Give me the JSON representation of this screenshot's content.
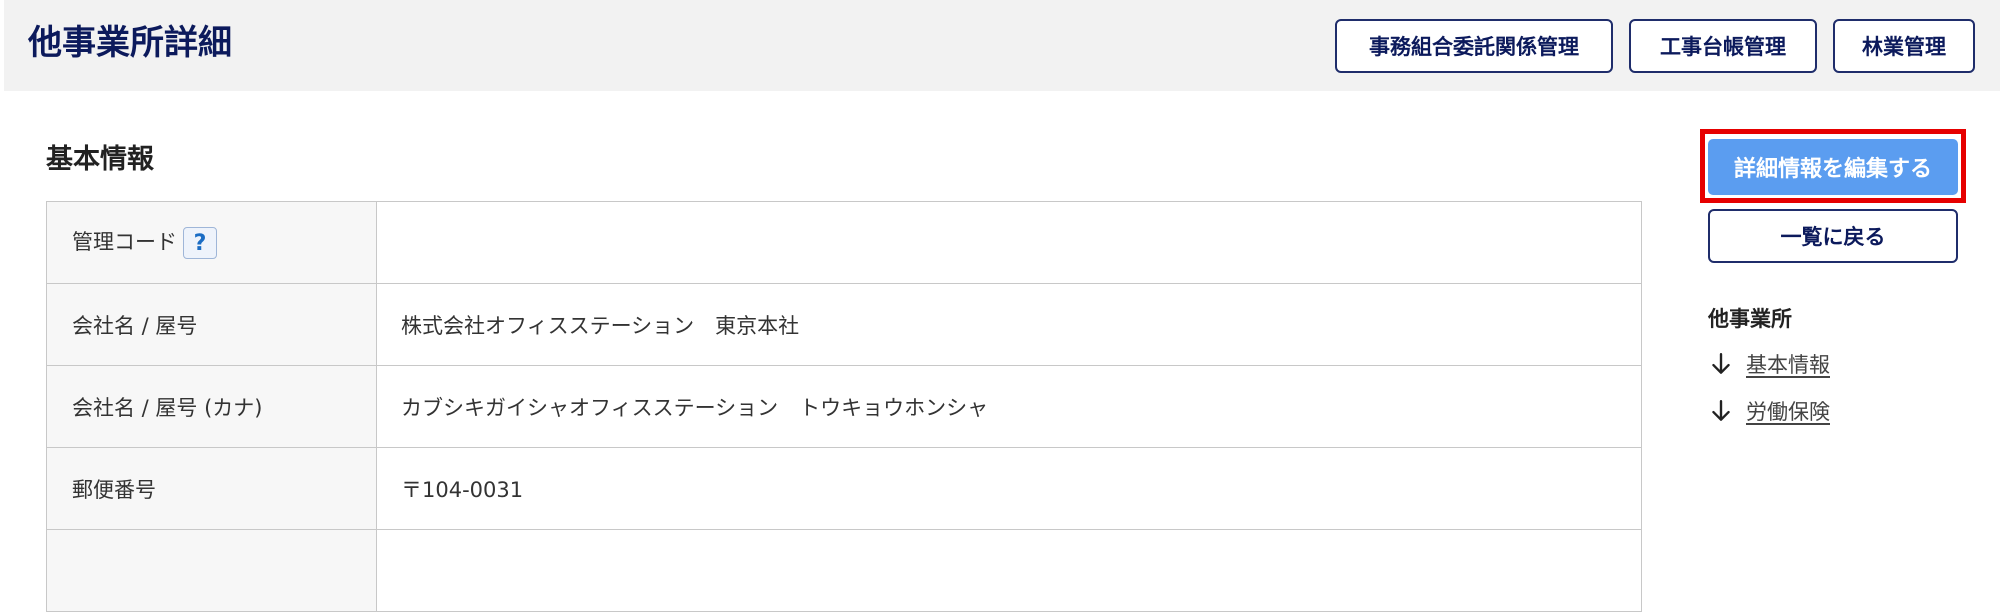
{
  "header": {
    "title": "他事業所詳細",
    "buttons": [
      "事務組合委託関係管理",
      "工事台帳管理",
      "林業管理"
    ]
  },
  "basic_info": {
    "section_title": "基本情報",
    "rows": [
      {
        "label": "管理コード",
        "value": "",
        "help": "?"
      },
      {
        "label": "会社名 / 屋号",
        "value": "株式会社オフィスステーション　東京本社"
      },
      {
        "label": "会社名 / 屋号 (カナ)",
        "value": "カブシキガイシャオフィスステーション　トウキョウホンシャ"
      },
      {
        "label": "郵便番号",
        "value": "〒104-0031"
      }
    ]
  },
  "side": {
    "edit_button": "詳細情報を編集する",
    "back_button": "一覧に戻る",
    "nav_heading": "他事業所",
    "nav_links": [
      "基本情報",
      "労働保険"
    ],
    "nav_icon": "arrow-down-icon"
  },
  "colors": {
    "title_navy": "#0c1a5c",
    "header_bg": "#f2f2f2",
    "edit_button_bg": "#5b9df0",
    "highlight_red": "#e60000"
  }
}
